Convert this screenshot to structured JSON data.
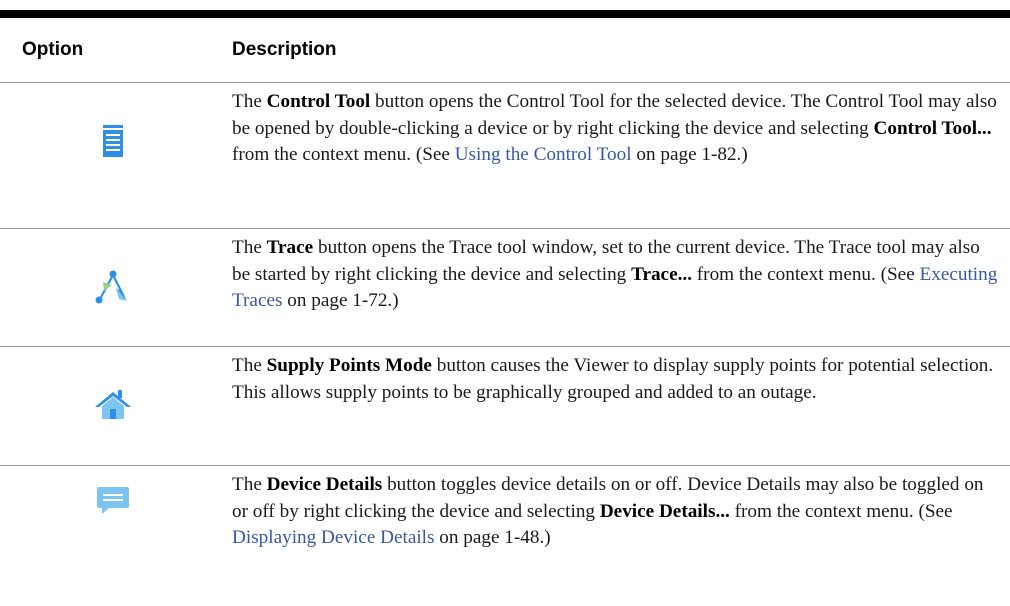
{
  "header": {
    "option": "Option",
    "description": "Description"
  },
  "rows": [
    {
      "icon": "control-tool-icon",
      "segments": [
        {
          "t": "The "
        },
        {
          "b": "Control Tool"
        },
        {
          "t": " button opens the Control Tool for the selected device. The Control Tool may also be opened by double-clicking a device or by right clicking the device and selecting "
        },
        {
          "b": "Control Tool..."
        },
        {
          "t": " from the context menu. (See "
        },
        {
          "l": "Using the Control Tool"
        },
        {
          "t": " on page 1-82.)"
        }
      ]
    },
    {
      "icon": "trace-icon",
      "segments": [
        {
          "t": "The "
        },
        {
          "b": "Trace"
        },
        {
          "t": " button opens the Trace tool window, set to the current device. The Trace tool may also be started by right clicking the device and selecting "
        },
        {
          "b": "Trace..."
        },
        {
          "t": " from the context menu. (See "
        },
        {
          "l": "Executing Traces"
        },
        {
          "t": " on page 1-72.)"
        }
      ]
    },
    {
      "icon": "supply-points-home-icon",
      "segments": [
        {
          "t": "The "
        },
        {
          "b": "Supply Points Mode"
        },
        {
          "t": " button causes the Viewer to display supply points for potential selection. This allows supply points to be graphically grouped and added to an outage."
        }
      ]
    },
    {
      "icon": "device-details-speech-bubble-icon",
      "segments": [
        {
          "t": "The "
        },
        {
          "b": "Device Details"
        },
        {
          "t": " button toggles device details on or off. Device Details may also be toggled on or off by right clicking the device and selecting "
        },
        {
          "b": "Device Details..."
        },
        {
          "t": " from the context menu. (See "
        },
        {
          "l": "Displaying Device Details"
        },
        {
          "t": " on page 1-48.)"
        }
      ]
    }
  ],
  "colors": {
    "icon_primary": "#2f8ee5",
    "icon_light": "#7cc4f2",
    "link": "#3b57a4",
    "rule": "#000000"
  }
}
